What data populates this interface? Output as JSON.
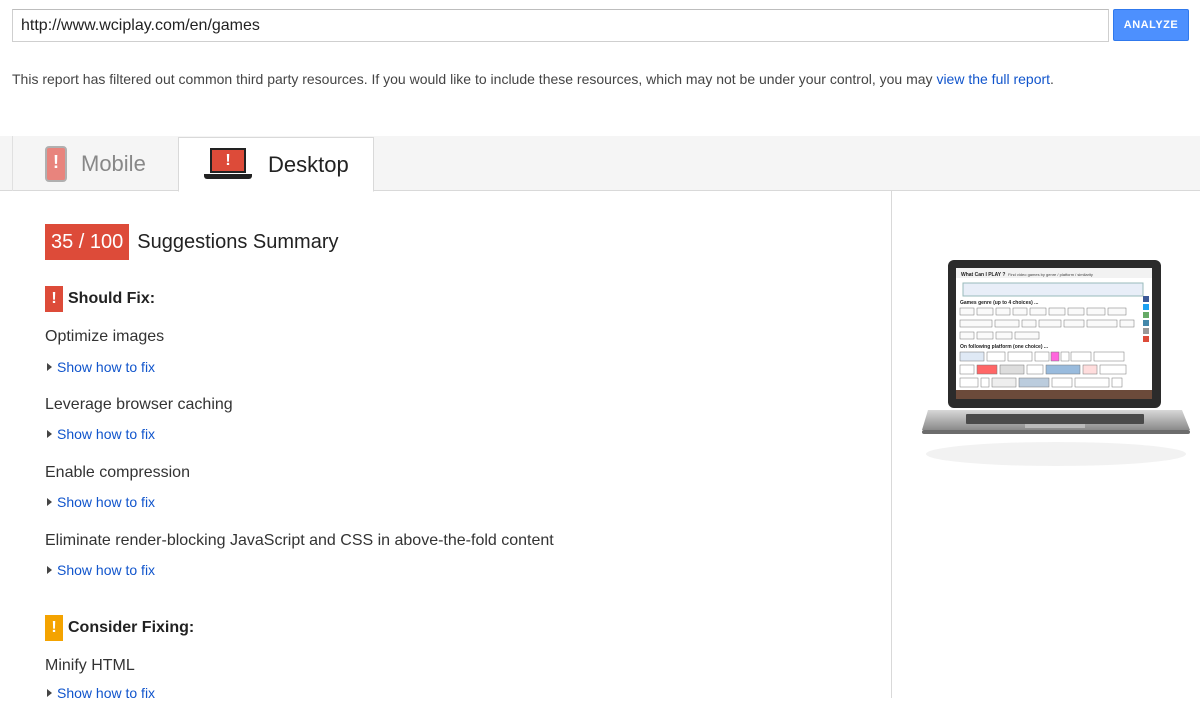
{
  "url_bar": {
    "value": "http://www.wciplay.com/en/games",
    "analyze_label": "ANALYZE"
  },
  "notice": {
    "text": "This report has filtered out common third party resources. If you would like to include these resources, which may not be under your control, you may ",
    "link": "view the full report",
    "suffix": "."
  },
  "tabs": [
    {
      "label": "Mobile",
      "icon": "phone-icon",
      "active": false
    },
    {
      "label": "Desktop",
      "icon": "laptop-icon",
      "active": true
    }
  ],
  "score": {
    "value": "35 / 100",
    "title": "Suggestions Summary",
    "color": "#dd4b39"
  },
  "should_fix": {
    "heading": "Should Fix:",
    "color": "#dd4b39",
    "items": [
      {
        "title": "Optimize images",
        "link": "Show how to fix"
      },
      {
        "title": "Leverage browser caching",
        "link": "Show how to fix"
      },
      {
        "title": "Enable compression",
        "link": "Show how to fix"
      },
      {
        "title": "Eliminate render-blocking JavaScript and CSS in above-the-fold content",
        "link": "Show how to fix"
      }
    ]
  },
  "consider_fixing": {
    "heading": "Consider Fixing:",
    "color": "#f4a300",
    "items": [
      {
        "title": "Minify HTML",
        "link": "Show how to fix"
      }
    ]
  },
  "preview": {
    "icon": "laptop-preview-image",
    "site_title": "What Can I PLAY ?",
    "site_tagline": "Find video games by genre / platform / similarity",
    "section1": "Games genre (up to 4 choices) ...",
    "section2": "On following platform (one choice) ..."
  }
}
